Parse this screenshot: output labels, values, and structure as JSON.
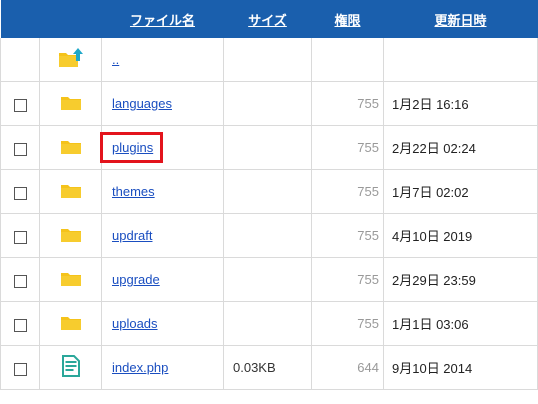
{
  "header": {
    "name": "ファイル名",
    "size": "サイズ",
    "perm": "権限",
    "date": "更新日時"
  },
  "colors": {
    "header_bg": "#1a5fad",
    "link": "#1a4ec0",
    "highlight": "#e3141c",
    "folder": "#f5c31a",
    "file": "#2aa79a"
  },
  "rows": [
    {
      "name": "..",
      "size": "",
      "perm": "",
      "date": "",
      "icon": "parent-folder-icon",
      "checkbox": false,
      "highlight": false
    },
    {
      "name": "languages",
      "size": "",
      "perm": "755",
      "date": "1月2日 16:16",
      "icon": "folder-icon",
      "checkbox": true,
      "highlight": false
    },
    {
      "name": "plugins",
      "size": "",
      "perm": "755",
      "date": "2月22日 02:24",
      "icon": "folder-icon",
      "checkbox": true,
      "highlight": true
    },
    {
      "name": "themes",
      "size": "",
      "perm": "755",
      "date": "1月7日 02:02",
      "icon": "folder-icon",
      "checkbox": true,
      "highlight": false
    },
    {
      "name": "updraft",
      "size": "",
      "perm": "755",
      "date": "4月10日 2019",
      "icon": "folder-icon",
      "checkbox": true,
      "highlight": false
    },
    {
      "name": "upgrade",
      "size": "",
      "perm": "755",
      "date": "2月29日 23:59",
      "icon": "folder-icon",
      "checkbox": true,
      "highlight": false
    },
    {
      "name": "uploads",
      "size": "",
      "perm": "755",
      "date": "1月1日 03:06",
      "icon": "folder-icon",
      "checkbox": true,
      "highlight": false
    },
    {
      "name": "index.php",
      "size": "0.03KB",
      "perm": "644",
      "date": "9月10日 2014",
      "icon": "file-icon",
      "checkbox": true,
      "highlight": false
    }
  ]
}
